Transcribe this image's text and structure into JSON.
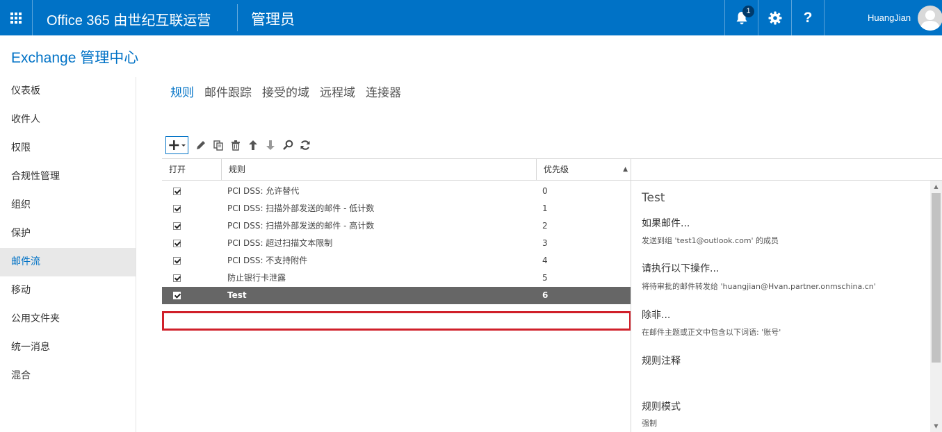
{
  "topbar": {
    "brand": "Office 365 由世纪互联运营",
    "section": "管理员",
    "notifications_count": "1",
    "help": "?",
    "username": "HuangJian"
  },
  "page_title": "Exchange 管理中心",
  "nav": [
    {
      "label": "仪表板"
    },
    {
      "label": "收件人"
    },
    {
      "label": "权限"
    },
    {
      "label": "合规性管理"
    },
    {
      "label": "组织"
    },
    {
      "label": "保护"
    },
    {
      "label": "邮件流",
      "active": true
    },
    {
      "label": "移动"
    },
    {
      "label": "公用文件夹"
    },
    {
      "label": "统一消息"
    },
    {
      "label": "混合"
    }
  ],
  "tabs": [
    "规则",
    "邮件跟踪",
    "接受的域",
    "远程域",
    "连接器"
  ],
  "table": {
    "headers": {
      "open": "打开",
      "rule": "规则",
      "priority": "优先级"
    },
    "rows": [
      {
        "name": "PCI DSS: 允许替代",
        "priority": "0"
      },
      {
        "name": "PCI DSS: 扫描外部发送的邮件 - 低计数",
        "priority": "1"
      },
      {
        "name": "PCI DSS: 扫描外部发送的邮件 - 高计数",
        "priority": "2"
      },
      {
        "name": "PCI DSS: 超过扫描文本限制",
        "priority": "3"
      },
      {
        "name": "PCI DSS: 不支持附件",
        "priority": "4"
      },
      {
        "name": "防止银行卡泄露",
        "priority": "5"
      },
      {
        "name": "Test",
        "priority": "6"
      }
    ]
  },
  "details": {
    "title": "Test",
    "if_heading": "如果邮件...",
    "if_text": "发送到组 'test1@outlook.com' 的成员",
    "do_heading": "请执行以下操作...",
    "do_text": "将待审批的邮件转发给 'huangjian@Hvan.partner.onmschina.cn'",
    "except_heading": "除非...",
    "except_text": "在邮件主题或正文中包含以下词语: '账号'",
    "comments_heading": "规则注释",
    "mode_heading": "规则模式",
    "mode_text": "强制"
  },
  "colors": {
    "accent": "#0072c6",
    "selected_row": "#666666",
    "highlight_outline": "#d0202a"
  }
}
